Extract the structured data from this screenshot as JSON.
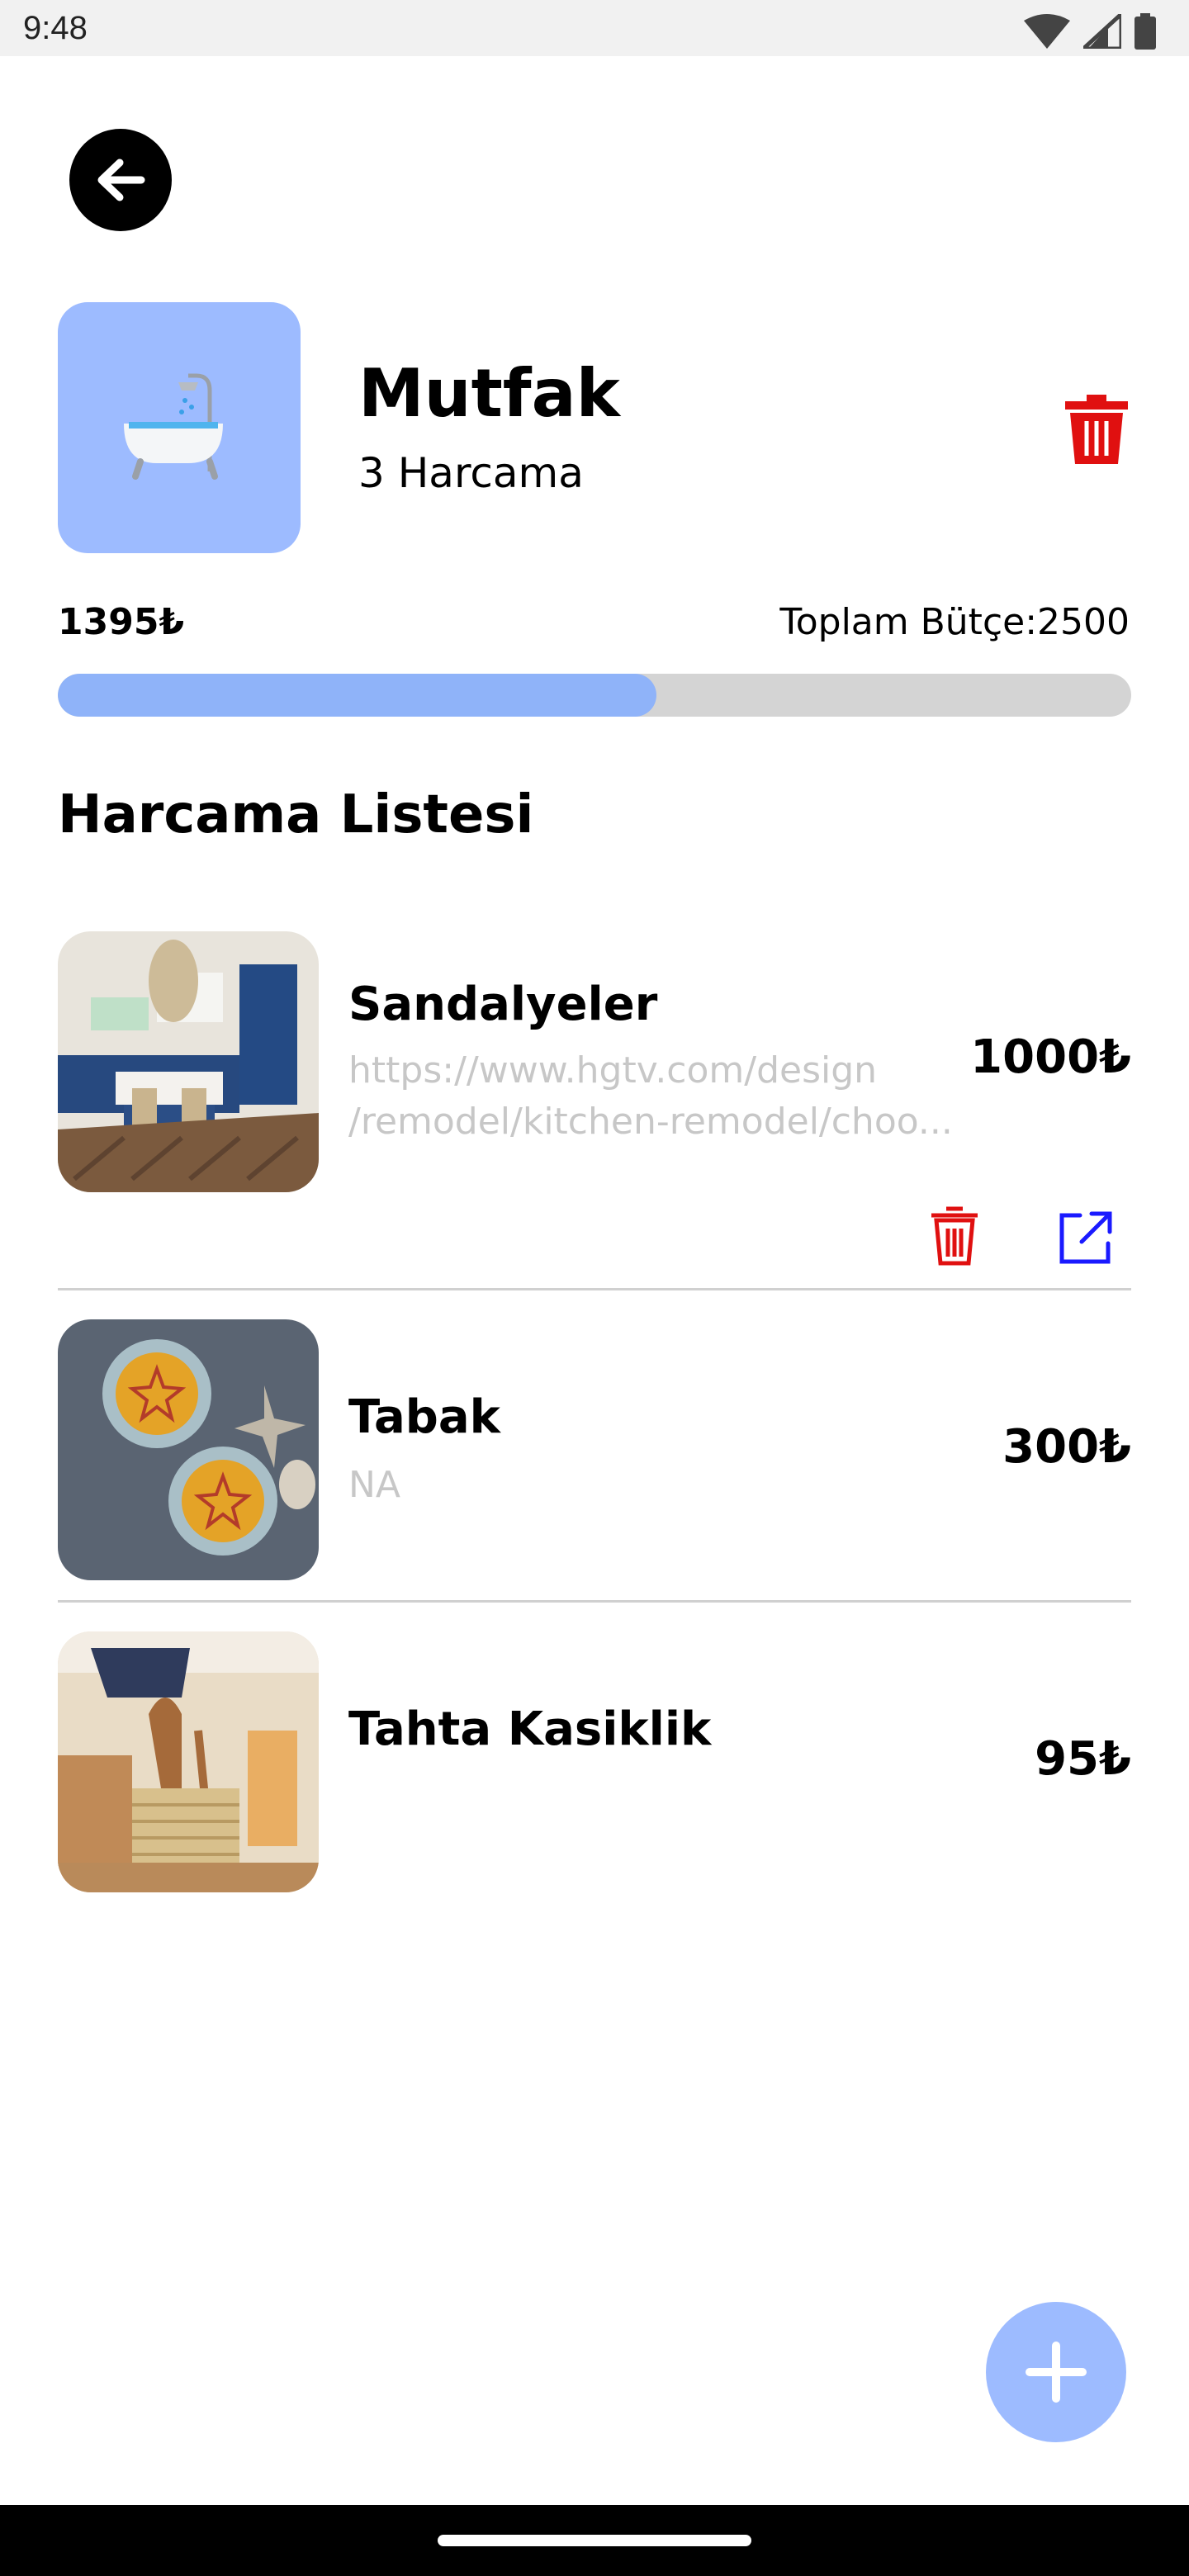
{
  "status_bar": {
    "time": "9:48",
    "icons": [
      "wifi-icon",
      "signal-icon",
      "battery-icon"
    ]
  },
  "header": {
    "back_icon": "arrow-left-icon"
  },
  "category": {
    "icon": "bathtub-icon",
    "title": "Mutfak",
    "subtitle": "3 Harcama",
    "delete_icon": "trash-icon",
    "tile_color": "#9dbbff"
  },
  "budget": {
    "spent": "1395₺",
    "total_label": "Toplam Bütçe:2500",
    "progress_fraction": 0.558,
    "fill_color": "#8fb3f9"
  },
  "list": {
    "title": "Harcama Listesi",
    "items": [
      {
        "name": "Sandalyeler",
        "link_line1": "https://www.hgtv.com/design",
        "link_line2": "/remodel/kitchen-remodel/choo...",
        "price": "1000₺",
        "actions": [
          "trash-icon",
          "external-link-icon"
        ]
      },
      {
        "name": "Tabak",
        "link_line1": "NA",
        "price": "300₺"
      },
      {
        "name": "Tahta Kasiklik",
        "price": "95₺"
      }
    ]
  },
  "fab": {
    "icon": "plus-icon"
  },
  "accent_colors": {
    "delete": "#e01010",
    "open": "#1a1aff"
  }
}
